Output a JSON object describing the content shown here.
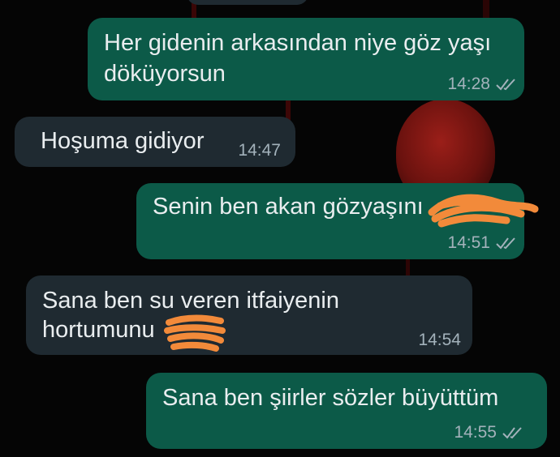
{
  "chat": {
    "messages": [
      {
        "direction": "outgoing",
        "text_line1": "Her gidenin arkasından niye göz yaşı",
        "text_line2": "döküyorsun",
        "time": "14:28",
        "status_icon": "double-check-icon"
      },
      {
        "direction": "incoming",
        "text": "Hoşuma gidiyor",
        "time": "14:47"
      },
      {
        "direction": "outgoing",
        "text": "Senin ben akan gözyaşını",
        "time": "14:51",
        "status_icon": "double-check-icon",
        "redacted": true
      },
      {
        "direction": "incoming",
        "text_line1": "Sana ben su veren itfaiyenin",
        "text_line2": "hortumunu",
        "time": "14:54",
        "redacted": true
      },
      {
        "direction": "outgoing",
        "text": "Sana ben şiirler sözler büyüttüm",
        "time": "14:55",
        "status_icon": "double-check-icon"
      }
    ]
  },
  "colors": {
    "outgoing_bubble": "#0c5a48",
    "incoming_bubble": "#1f2a31",
    "background": "#050505",
    "redaction": "#f28a3a"
  }
}
